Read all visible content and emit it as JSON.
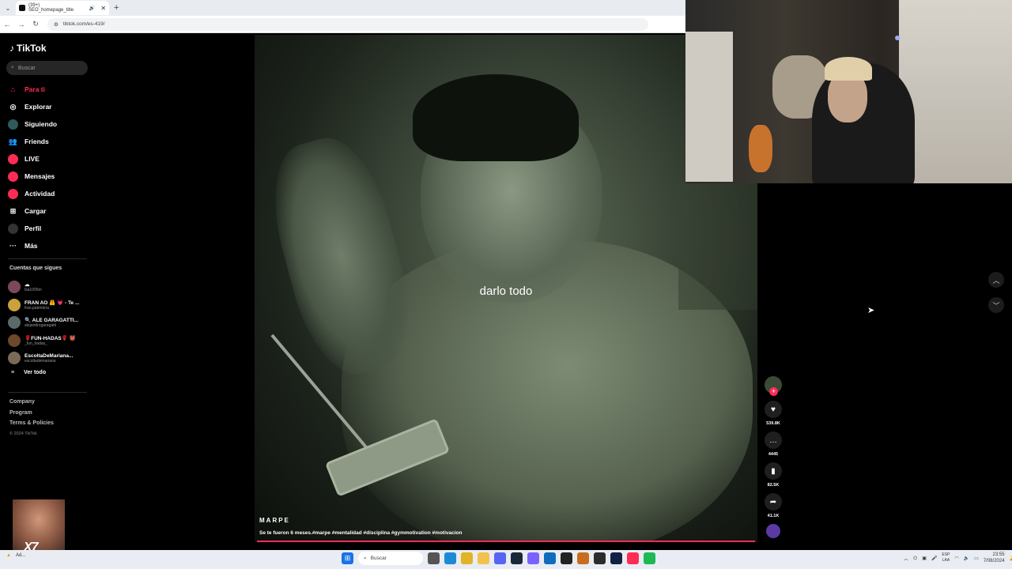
{
  "browser": {
    "tab_title": "(39+) SEO_homepage_title",
    "url": "tiktok.com/es-419/",
    "new_tab_symbol": "+",
    "close_symbol": "✕"
  },
  "sidebar": {
    "logo": "TikTok",
    "search_placeholder": "Buscar",
    "nav": [
      {
        "label": "Para ti",
        "icon": "home-icon"
      },
      {
        "label": "Explorar",
        "icon": "compass-icon"
      },
      {
        "label": "Siguiendo",
        "icon": "following-icon"
      },
      {
        "label": "Friends",
        "icon": "friends-icon"
      },
      {
        "label": "LIVE",
        "icon": "live-icon"
      },
      {
        "label": "Mensajes",
        "icon": "messages-icon"
      },
      {
        "label": "Actividad",
        "icon": "activity-icon"
      },
      {
        "label": "Cargar",
        "icon": "upload-icon"
      },
      {
        "label": "Perfil",
        "icon": "profile-icon"
      },
      {
        "label": "Más",
        "icon": "more-icon"
      }
    ],
    "following_title": "Cuentas que sigues",
    "following": [
      {
        "name": "☁",
        "handle": "lsa1005m"
      },
      {
        "name": "FRAN AO 🦺 💗 - Te ...",
        "handle": "fran.paternina"
      },
      {
        "name": "🔍 ALE GARAGATTI...",
        "handle": "alejandrogaragatti"
      },
      {
        "name": "🌹FUN-HADAS🌹 👹",
        "handle": "_fun_hadas_"
      },
      {
        "name": "EscoltaDeMariana...",
        "handle": "escoltademariana"
      }
    ],
    "see_all": "Ver todo",
    "footer": [
      "Company",
      "Program",
      "Terms & Policies"
    ],
    "copyright": "© 2024 TikTok"
  },
  "video": {
    "caption": "darlo todo",
    "author": "MARPE",
    "description": "Se te fueron 6 meses.#marpe #mentalidad #disciplina #gymmotivation #motivacion",
    "progress": 1.0
  },
  "actions": {
    "likes": "539.8K",
    "comments": "4445",
    "saves": "82.5K",
    "shares": "41.1K",
    "follow_plus": "+"
  },
  "taskbar": {
    "search_placeholder": "Buscar",
    "lang_line1": "ESP",
    "lang_line2": "LAA",
    "time": "23:55",
    "date": "7/08/2024",
    "left_text": "Ad..."
  },
  "colors": {
    "accent": "#fe2c55",
    "background": "#000000",
    "taskbar": "#e9edf3"
  }
}
